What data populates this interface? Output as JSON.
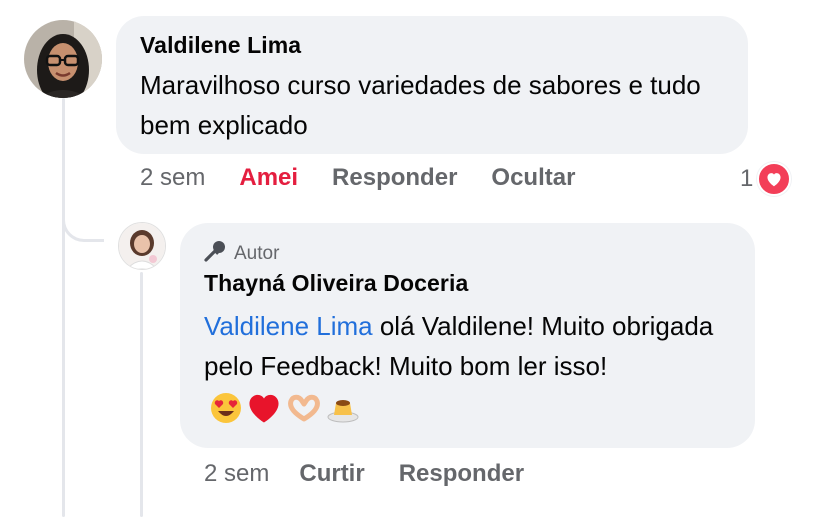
{
  "comment": {
    "author": "Valdilene Lima",
    "text": "Maravilhoso curso variedades de sabores e tudo bem explicado",
    "time": "2 sem",
    "reaction_label": "Amei",
    "reply_label": "Responder",
    "hide_label": "Ocultar",
    "reaction_count": "1",
    "reaction_icon": "heart-reaction-icon",
    "reaction_color": "#f33e58",
    "love_color": "#e41e3f"
  },
  "reply": {
    "badge_icon": "microphone-icon",
    "badge_label": "Autor",
    "author": "Thayná Oliveira Doceria",
    "mention": "Valdilene Lima",
    "text": " olá Valdilene! Muito obrigada pelo Feedback! Muito bom ler isso!",
    "emojis": [
      "heart-eyes-emoji",
      "red-heart-emoji",
      "heart-hands-emoji",
      "flan-emoji"
    ],
    "time": "2 sem",
    "like_label": "Curtir",
    "reply_label": "Responder",
    "mention_color": "#216fdb"
  },
  "colors": {
    "bubble": "#f0f2f5",
    "secondary_text": "#65676b"
  }
}
